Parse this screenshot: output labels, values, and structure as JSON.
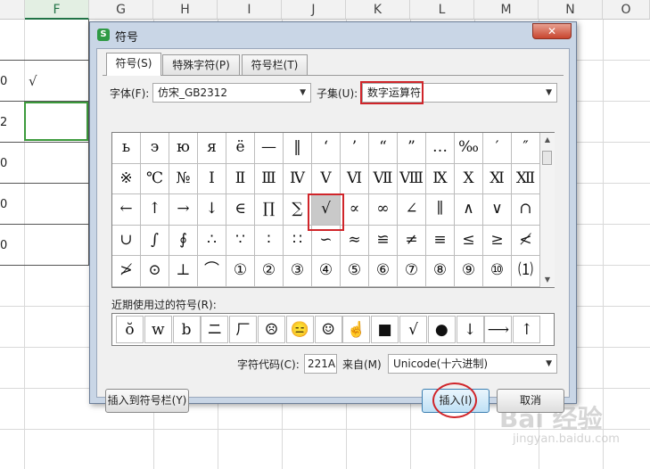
{
  "sheet": {
    "columns": [
      "F",
      "G",
      "H",
      "I",
      "J",
      "K",
      "L",
      "M",
      "N",
      "O"
    ],
    "selected_column": "F",
    "row_values": [
      "0",
      "2",
      "0",
      "0",
      "0"
    ],
    "cell_check": "√"
  },
  "watermark": {
    "main": "Bai 经验",
    "sub": "jingyan.baidu.com"
  },
  "dialog": {
    "app_icon": "S",
    "title": "符号",
    "close_label": "✕",
    "tabs": [
      "符号(S)",
      "特殊字符(P)",
      "符号栏(T)"
    ],
    "active_tab": 0,
    "font_label": "字体(F):",
    "font_value": "仿宋_GB2312",
    "subset_label": "子集(U):",
    "subset_value": "数字运算符",
    "symbol_grid": [
      [
        "ь",
        "э",
        "ю",
        "я",
        "ё",
        "—",
        "‖",
        "‘",
        "’",
        "“",
        "”",
        "…",
        "‰",
        "′",
        "″"
      ],
      [
        "※",
        "℃",
        "№",
        "Ⅰ",
        "Ⅱ",
        "Ⅲ",
        "Ⅳ",
        "Ⅴ",
        "Ⅵ",
        "Ⅶ",
        "Ⅷ",
        "Ⅸ",
        "Ⅹ",
        "Ⅺ",
        "Ⅻ"
      ],
      [
        "←",
        "↑",
        "→",
        "↓",
        "∈",
        "∏",
        "∑",
        "√",
        "∝",
        "∞",
        "∠",
        "∥",
        "∧",
        "∨",
        "∩"
      ],
      [
        "∪",
        "∫",
        "∮",
        "∴",
        "∵",
        "∶",
        "∷",
        "∽",
        "≈",
        "≌",
        "≠",
        "≡",
        "≤",
        "≥",
        "≮"
      ],
      [
        "≯",
        "⊙",
        "⊥",
        "⌒",
        "①",
        "②",
        "③",
        "④",
        "⑤",
        "⑥",
        "⑦",
        "⑧",
        "⑨",
        "⑩",
        "⑴"
      ]
    ],
    "selected_symbol": "√",
    "recent_label": "近期使用过的符号(R):",
    "recent_symbols": [
      "ŏ",
      "w",
      "b",
      "ニ",
      "ㄏ",
      "☹",
      "😑",
      "☺",
      "☝",
      "■",
      "√",
      "●",
      "↓",
      "⟶",
      "↑"
    ],
    "charcode_label": "字符代码(C):",
    "charcode_value": "221A",
    "from_label": "来自(M)",
    "from_value": "Unicode(十六进制)",
    "insert_to_bar_label": "插入到符号栏(Y)",
    "insert_label": "插入(I)",
    "cancel_label": "取消"
  }
}
